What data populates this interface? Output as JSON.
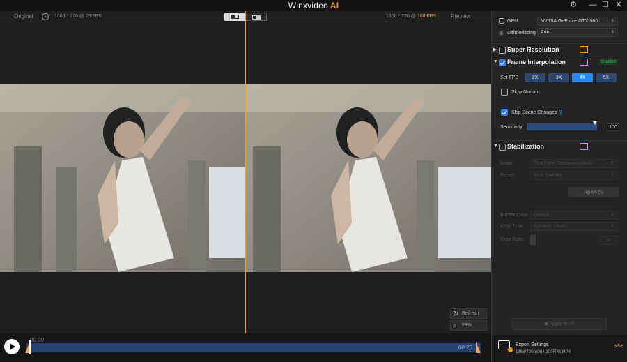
{
  "app": {
    "title": "Winxvideo",
    "title_suffix": "AI"
  },
  "window": {
    "minimize": "—",
    "maximize": "☐",
    "close": "✕",
    "settings": "⚙"
  },
  "preview": {
    "left_label": "Original",
    "left_info": "1366 * 720 @ 25 FPS",
    "right_info_prefix": "1366 * 720 @",
    "right_info_fps": "100 FPS",
    "right_label": "Preview",
    "refresh_label": "Refresh",
    "zoom_label": "58%"
  },
  "timeline": {
    "start": "00:00",
    "end": "00:25"
  },
  "panel": {
    "gpu_label": "GPU",
    "gpu_value": "NVIDIA GeForce GTX 980",
    "deinterlacing_label": "Deinterlacing",
    "deinterlacing_value": "Auto",
    "super_resolution": "Super Resolution",
    "frame_interpolation": "Frame Interpolation",
    "enabled_badge": "Enabled",
    "set_fps_label": "Set FPS",
    "fps_options": [
      "2X",
      "3X",
      "4X",
      "5X"
    ],
    "slow_motion": "Slow Motion",
    "skip_scene_changes": "Skip Scene Changes",
    "help": "?",
    "sensitivity_label": "Sensitivity",
    "sensitivity_value": "100",
    "stabilization": "Stabilization",
    "mode_label": "Mode",
    "mode_value": "Two Pass (Recommended)",
    "preset_label": "Preset",
    "preset_value": "Best Stability",
    "analyze": "Analyze",
    "border_color_label": "Border Color",
    "border_color_value": "Default",
    "crop_type_label": "Crop Type",
    "crop_type_value": "Dynamic (Auto)",
    "crop_ratio_label": "Crop Ratio",
    "crop_ratio_value": "0",
    "apply_all": "Apply to All",
    "export_title": "Export Settings",
    "export_details": "1366*720  H264  100FPS  MP4"
  }
}
